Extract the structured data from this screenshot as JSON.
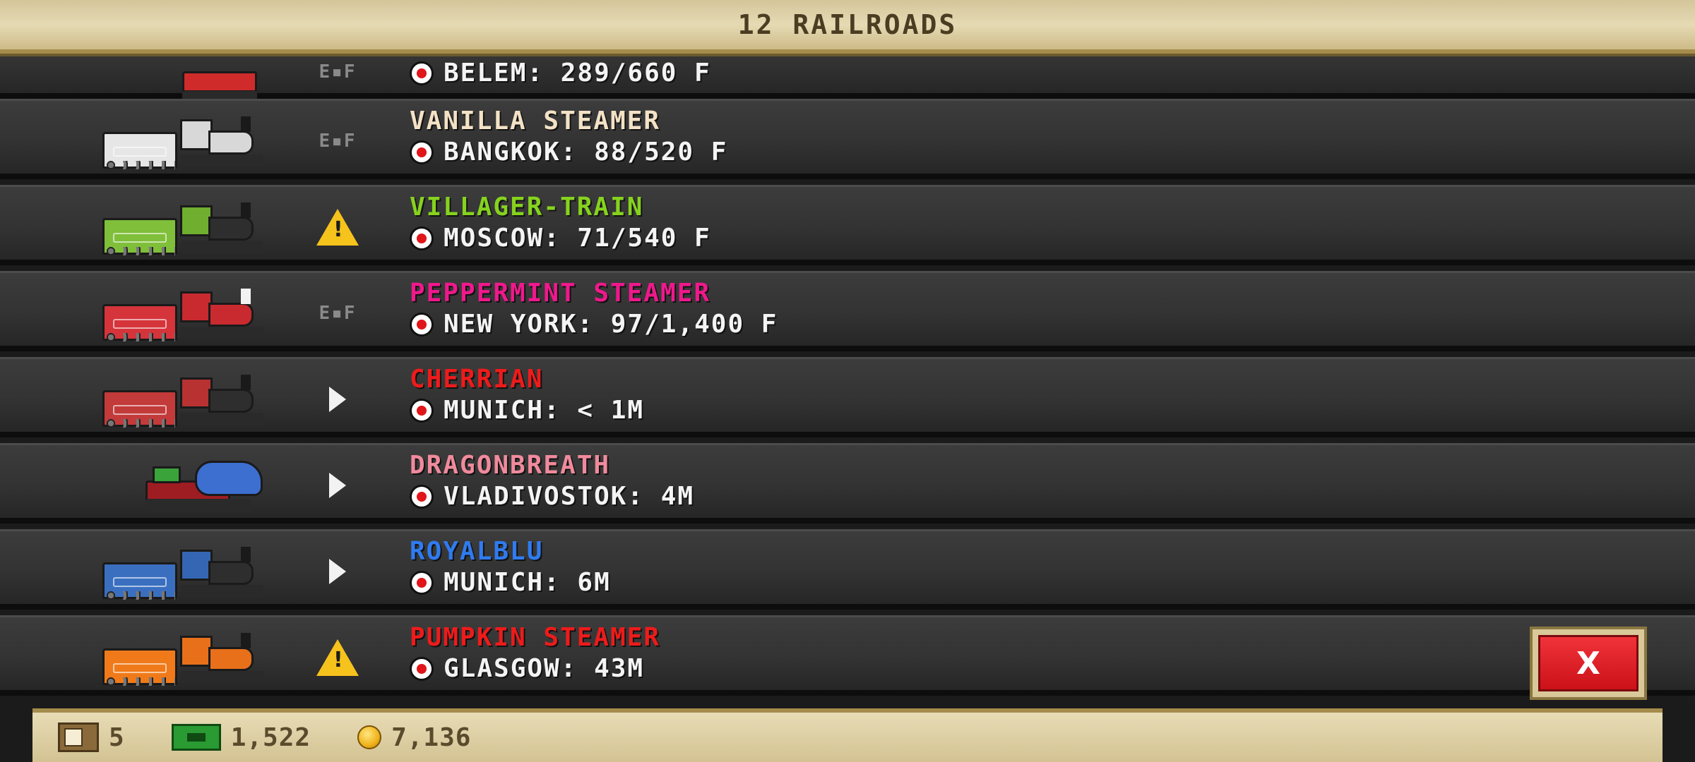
{
  "header": {
    "title": "12 RAILROADS"
  },
  "colors": {
    "vanilla": "#f4e2c6",
    "villager": "#86d21e",
    "peppermint": "#f0188c",
    "cherrian": "#ee1b1b",
    "dragon": "#f08a9c",
    "royal": "#2f7bf0",
    "pumpkin": "#ee1b1b"
  },
  "trains": [
    {
      "name": "",
      "destination": "BELEM: 289/660 F",
      "status": "fuel",
      "status_text": "E▪F",
      "tender_color": "#c8c8c8",
      "loco_color": "#cf2b2b"
    },
    {
      "name": "VANILLA STEAMER",
      "destination": "BANGKOK: 88/520 F",
      "status": "fuel",
      "status_text": "E▪F",
      "tender_color": "#e6e6e6",
      "loco_color": "#d8d8d8"
    },
    {
      "name": "VILLAGER-TRAIN",
      "destination": "MOSCOW: 71/540 F",
      "status": "warning",
      "status_text": "!",
      "tender_color": "#7fbf3a",
      "loco_color": "#6fae2e"
    },
    {
      "name": "PEPPERMINT STEAMER",
      "destination": "NEW YORK: 97/1,400 F",
      "status": "fuel",
      "status_text": "E▪F",
      "tender_color": "#d4343a",
      "loco_color": "#c92a30"
    },
    {
      "name": "CHERRIAN",
      "destination": "MUNICH: < 1M",
      "status": "play",
      "status_text": "",
      "tender_color": "#c23a3a",
      "loco_color": "#b83232"
    },
    {
      "name": "DRAGONBREATH",
      "destination": "VLADIVOSTOK: 4M",
      "status": "play",
      "status_text": "",
      "tender_color": "#3aa33a",
      "loco_color": "#b8302f"
    },
    {
      "name": "ROYALBLU",
      "destination": "MUNICH: 6M",
      "status": "play",
      "status_text": "",
      "tender_color": "#3a6fc0",
      "loco_color": "#3566b3"
    },
    {
      "name": "PUMPKIN STEAMER",
      "destination": "GLASGOW: 43M",
      "status": "warning",
      "status_text": "!",
      "tender_color": "#f07a1a",
      "loco_color": "#e8701a"
    }
  ],
  "close_button": {
    "label": "X"
  },
  "footer": {
    "tickets": "5",
    "cash": "1,522",
    "coins": "7,136"
  }
}
